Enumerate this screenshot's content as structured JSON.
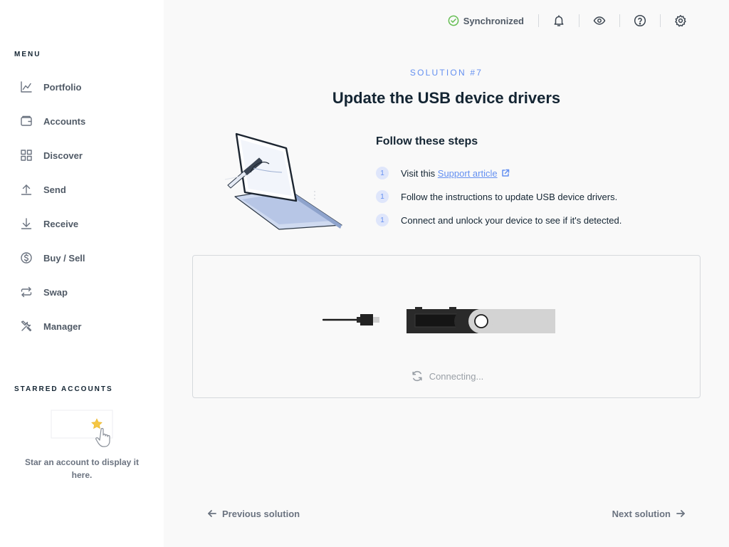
{
  "sidebar": {
    "menu_title": "MENU",
    "items": [
      {
        "label": "Portfolio",
        "icon": "chart-line-icon"
      },
      {
        "label": "Accounts",
        "icon": "wallet-icon"
      },
      {
        "label": "Discover",
        "icon": "grid-icon"
      },
      {
        "label": "Send",
        "icon": "arrow-up-icon"
      },
      {
        "label": "Receive",
        "icon": "arrow-down-icon"
      },
      {
        "label": "Buy / Sell",
        "icon": "dollar-coin-icon"
      },
      {
        "label": "Swap",
        "icon": "swap-icon"
      },
      {
        "label": "Manager",
        "icon": "tools-icon"
      }
    ],
    "starred_title": "STARRED ACCOUNTS",
    "starred_empty_text": "Star an account to display it here."
  },
  "topbar": {
    "sync_status": "Synchronized",
    "icons": [
      "bell-icon",
      "eye-icon",
      "help-icon",
      "settings-icon"
    ]
  },
  "main": {
    "solution_label": "SOLUTION #7",
    "title": "Update the USB device drivers",
    "steps_title": "Follow these steps",
    "steps": [
      {
        "number": "1",
        "prefix": "Visit this ",
        "link": "Support article"
      },
      {
        "number": "1",
        "text": "Follow the instructions to update USB device drivers."
      },
      {
        "number": "1",
        "text": "Connect and unlock your device to see if it's detected."
      }
    ],
    "connecting_text": "Connecting...",
    "prev_label": "Previous solution",
    "next_label": "Next solution"
  },
  "colors": {
    "accent": "#6490f1",
    "success": "#66be54",
    "text_primary": "#142533",
    "text_secondary": "#6b7380",
    "sidebar_bg": "#ffffff",
    "main_bg": "#f9f9f9"
  }
}
